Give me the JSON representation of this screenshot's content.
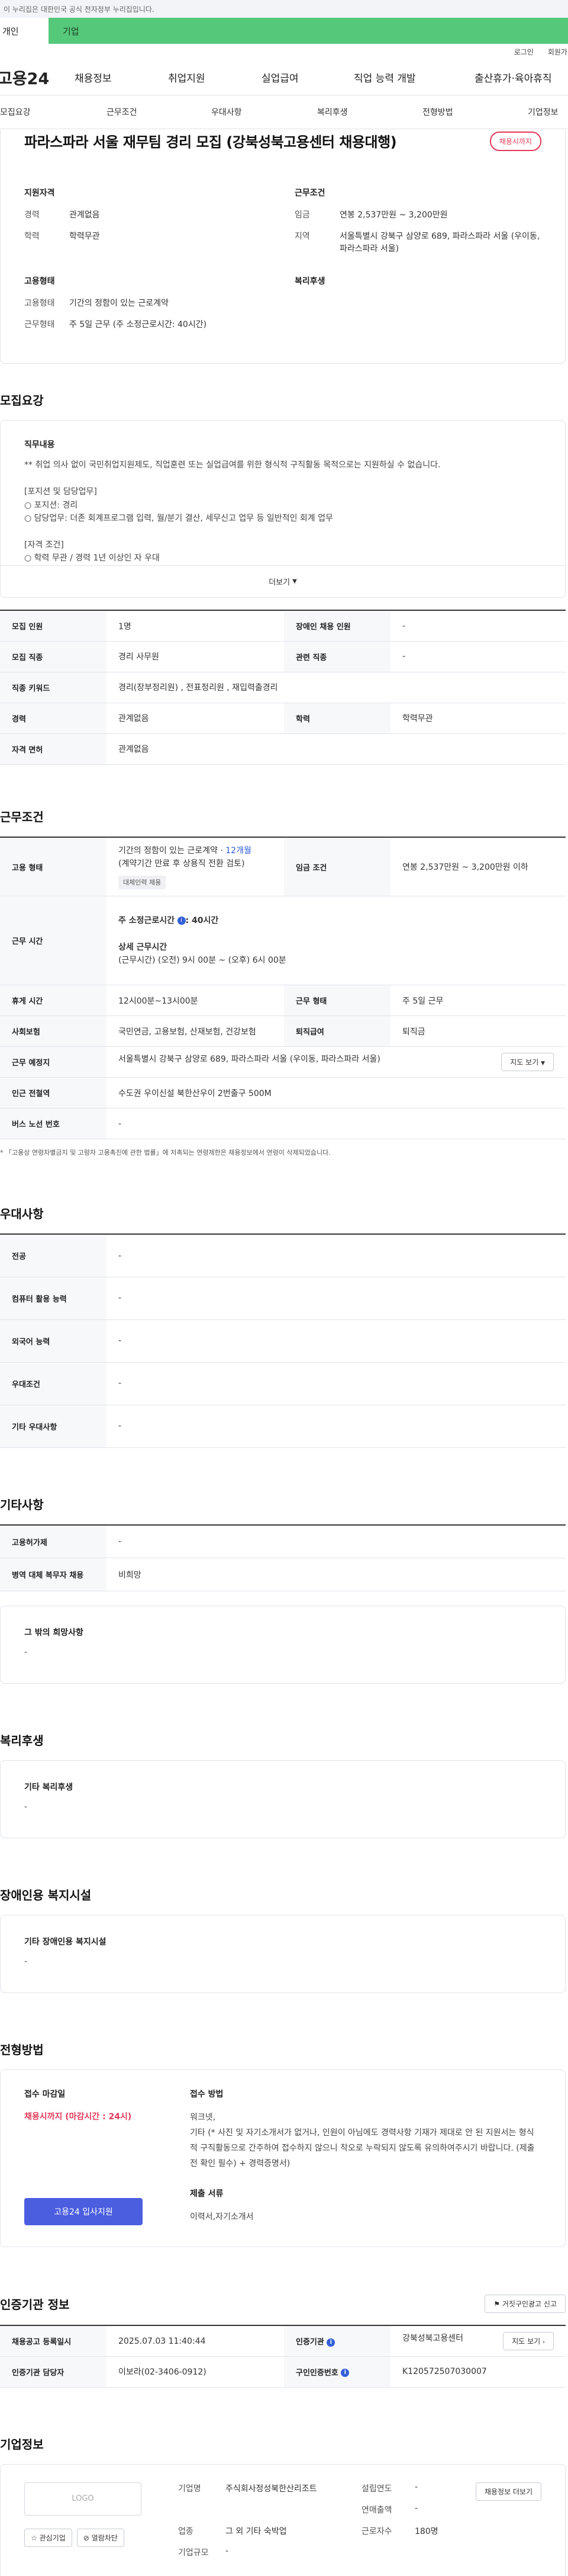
{
  "gov_banner": "이 누리집은 대한민국 공식 전자정부 누리집입니다.",
  "user_tabs": {
    "individual": "개인",
    "business": "기업"
  },
  "util_links": {
    "login": "로그인",
    "join": "회원가입"
  },
  "site_logo": "고용24",
  "gnb": [
    "채용정보",
    "취업지원",
    "실업급여",
    "직업 능력 개발",
    "출산휴가·육아휴직"
  ],
  "subnav": [
    "모집요강",
    "근무조건",
    "우대사항",
    "복리후생",
    "전형방법",
    "기업정보"
  ],
  "job": {
    "title": "파라스파라 서울 재무팀 경리 모집 (강북성북고용센터 채용대행)",
    "badge": "채용시까지",
    "qual_heading": "지원자격",
    "cond_heading": "근무조건",
    "career_label": "경력",
    "career_value": "관계없음",
    "edu_label": "학력",
    "edu_value": "학력무관",
    "wage_label": "임금",
    "wage_value": "연봉 2,537만원 ~ 3,200만원",
    "region_label": "지역",
    "region_value": "서울특별시 강북구 삼양로 689, 파라스파라 서울 (우이동, 파라스파라 서울)",
    "emp_heading": "고용형태",
    "benefit_heading": "복리후생",
    "emp_label": "고용형태",
    "emp_value": "기간의 정함이 있는 근로계약",
    "worktype_label": "근무형태",
    "worktype_value": "주 5일 근무 (주 소정근로시간: 40시간)"
  },
  "recruit": {
    "heading": "모집요강",
    "jd_heading": "직무내용",
    "jd_text": "** 취업 의사 없이 국민취업지원제도, 직업훈련 또는 실업급여를 위한 형식적 구직활동 목적으로는 지원하실 수 없습니다.\n\n[포지션 및 담당업무]\n○ 포지션: 경리\n○ 담당업무: 더존 회계프로그램 입력, 월/분기 결산, 세무신고 업무 등 일반적인 회계 업무\n\n[자격 조건]\n○ 학력 무관 / 경력 1년 이상인 자 우대\n○ 유관 업무 경력자 우대 / 인근 거주자 우대",
    "more": "더보기",
    "rows": {
      "count_label": "모집 인원",
      "count_value": "1명",
      "disabled_label": "장애인 채용 인원",
      "disabled_value": "-",
      "job_label": "모집 직종",
      "job_value": "경리 사무원",
      "related_label": "관련 직종",
      "related_value": "-",
      "keyword_label": "직종 키워드",
      "keyword_value": "경리(장부정리원) , 전표정리원 , 재입력출경리",
      "career_label": "경력",
      "career_value": "관계없음",
      "edu_label": "학력",
      "edu_value": "학력무관",
      "license_label": "자격 면허",
      "license_value": "관계없음"
    }
  },
  "work": {
    "heading": "근무조건",
    "emp_label": "고용 형태",
    "emp_value_pre": "기간의 정함이 있는 근로계약 · ",
    "emp_value_months": "12개월",
    "emp_value_note": "(계약기간 만료 후 상용직 전환 검토)",
    "emp_tag": "대체인력 채용",
    "wage_label": "임금 조건",
    "wage_value": "연봉 2,537만원 ~ 3,200만원 이하",
    "time_label": "근무 시간",
    "time_weekly": "주 소정근로시간",
    "time_weekly_value": ": 40시간",
    "time_detail_h": "상세 근무시간",
    "time_detail_v": "(근무시간) (오전) 9시 00분 ~ (오후) 6시 00분",
    "break_label": "휴게 시간",
    "break_value": "12시00분~13시00분",
    "worktype_label": "근무 형태",
    "worktype_value": "주 5일 근무",
    "insurance_label": "사회보험",
    "insurance_value": "국민연금, 고용보험, 산재보험, 건강보험",
    "severance_label": "퇴직급여",
    "severance_value": "퇴직금",
    "place_label": "근무 예정지",
    "place_value": "서울특별시 강북구 삼양로 689, 파라스파라 서울 (우이동, 파라스파라 서울)",
    "map_btn": "지도 보기",
    "subway_label": "인근 전철역",
    "subway_value": "수도권 우이신설 북한산우이 2번출구 500M",
    "bus_label": "버스 노선 번호",
    "bus_value": "-",
    "note": "* 「고용상 연령차별금지 및 고령자 고용촉진에 관한 법률」에 저촉되는 연령제한은 채용정보에서 연령이 삭제되었습니다."
  },
  "preference": {
    "heading": "우대사항",
    "rows": [
      {
        "label": "전공",
        "value": "-"
      },
      {
        "label": "컴퓨터 활용 능력",
        "value": "-"
      },
      {
        "label": "외국어 능력",
        "value": "-"
      },
      {
        "label": "우대조건",
        "value": "-"
      },
      {
        "label": "기타 우대사항",
        "value": "-"
      }
    ]
  },
  "etc": {
    "heading": "기타사항",
    "rows": [
      {
        "label": "고용허가제",
        "value": "-"
      },
      {
        "label": "병역 대체 복무자 채용",
        "value": "비희망"
      }
    ],
    "wish_h": "그 밖의 희망사항",
    "wish_v": "-"
  },
  "welfare": {
    "heading": "복리후생",
    "box_h": "기타 복리후생",
    "box_v": "-"
  },
  "disability": {
    "heading": "장애인용 복지시설",
    "box_h": "기타 장애인용 복지시설",
    "box_v": "-"
  },
  "selection": {
    "heading": "전형방법",
    "deadline_h": "접수 마감일",
    "deadline_v": "채용시까지 (마감시간 : 24시)",
    "apply_btn": "고용24 입사지원",
    "method_h": "접수 방법",
    "method_v": "워크넷,\n기타 (* 사진 및 자기소개서가 없거나, 인원이 아님에도 경력사항 기재가 제대로 안 된 지원서는 형식적 구직활동으로 간주하여 접수하지 않으니 착오로 누락되지 않도록 유의하여주시기 바랍니다. (제출 전 확인 필수) + 경력증명서)",
    "docs_h": "제출 서류",
    "docs_v": "이력서,자기소개서"
  },
  "agency": {
    "heading": "인증기관 정보",
    "report_btn": "거짓구인광고 신고",
    "reg_label": "채용공고 등록일시",
    "reg_value": "2025.07.03 11:40:44",
    "org_label": "인증기관",
    "org_value": "강북성북고용센터",
    "map_btn": "지도 보기",
    "manager_label": "인증기관 담당자",
    "manager_value": "이보라(02-3406-0912)",
    "reqno_label": "구인인증번호",
    "reqno_value": "K120572507030007"
  },
  "company": {
    "heading": "기업정보",
    "logo": "LOGO",
    "fav_btn": "관심기업",
    "see_btn": "열람차단",
    "info_btn": "채용정보 더보기",
    "name_label": "기업명",
    "name_value": "주식회사정성북한산리조트",
    "industry_label": "업종",
    "industry_value": "그 외 기타 숙박업",
    "size_label": "기업규모",
    "size_value": "-",
    "founded_label": "설립연도",
    "founded_value": "-",
    "sales_label": "연매출액",
    "sales_value": "-",
    "employees_label": "근로자수",
    "employees_value": "180명"
  }
}
